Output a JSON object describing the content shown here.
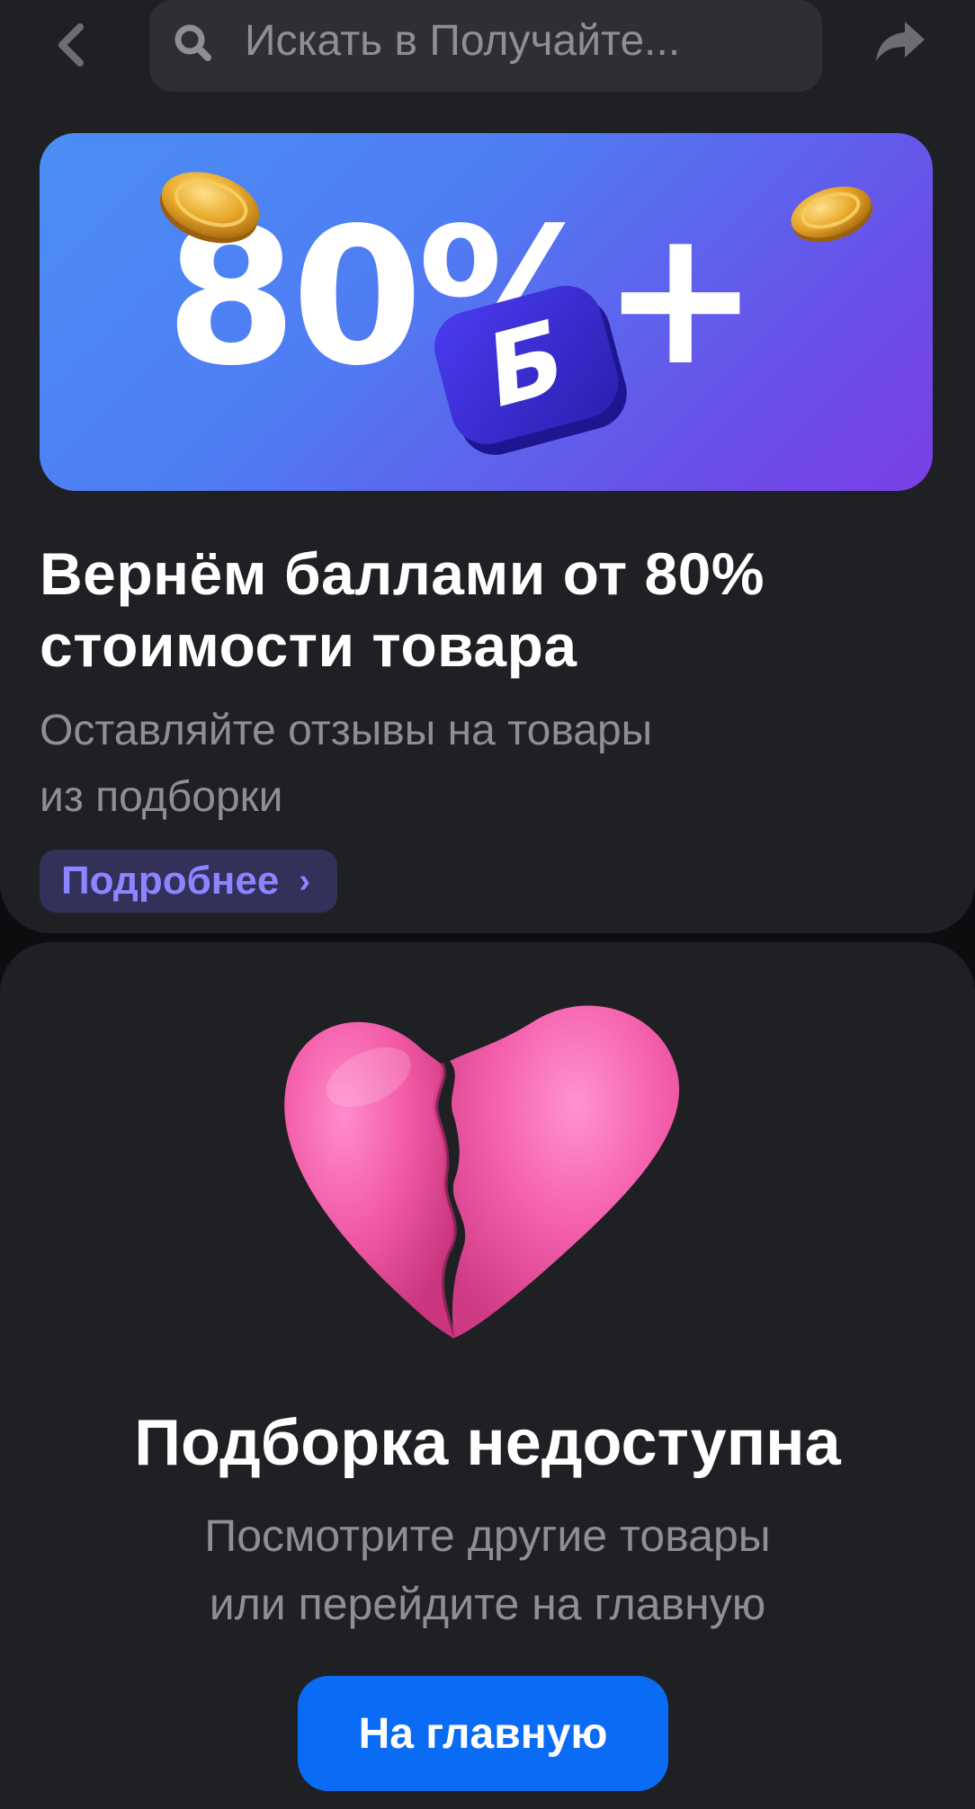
{
  "header": {
    "search_placeholder": "Искать в Получайте..."
  },
  "promo": {
    "banner_text": "80%+",
    "banner_badge": "Б",
    "title_line1": "Вернём баллами от 80%",
    "title_line2": "стоимости товара",
    "subtitle_line1": "Оставляйте отзывы на товары",
    "subtitle_line2": "из подборки",
    "more_label": "Подробнее",
    "more_chevron": "›"
  },
  "unavailable": {
    "title": "Подборка недоступна",
    "subtitle_line1": "Посмотрите другие товары",
    "subtitle_line2": "или перейдите на главную",
    "home_button_label": "На главную"
  },
  "icons": {
    "back": "chevron-left-icon",
    "search": "search-icon",
    "share": "share-arrow-icon",
    "heart": "broken-heart-icon",
    "coin": "coin-icon"
  },
  "colors": {
    "background": "#0d0d0f",
    "card": "#1f2024",
    "accent_blue": "#0a6cf5",
    "accent_violet": "#8d84ff",
    "banner_start": "#4a8ef5",
    "banner_end": "#7a3fe6",
    "heart_pink": "#f25aa6"
  }
}
